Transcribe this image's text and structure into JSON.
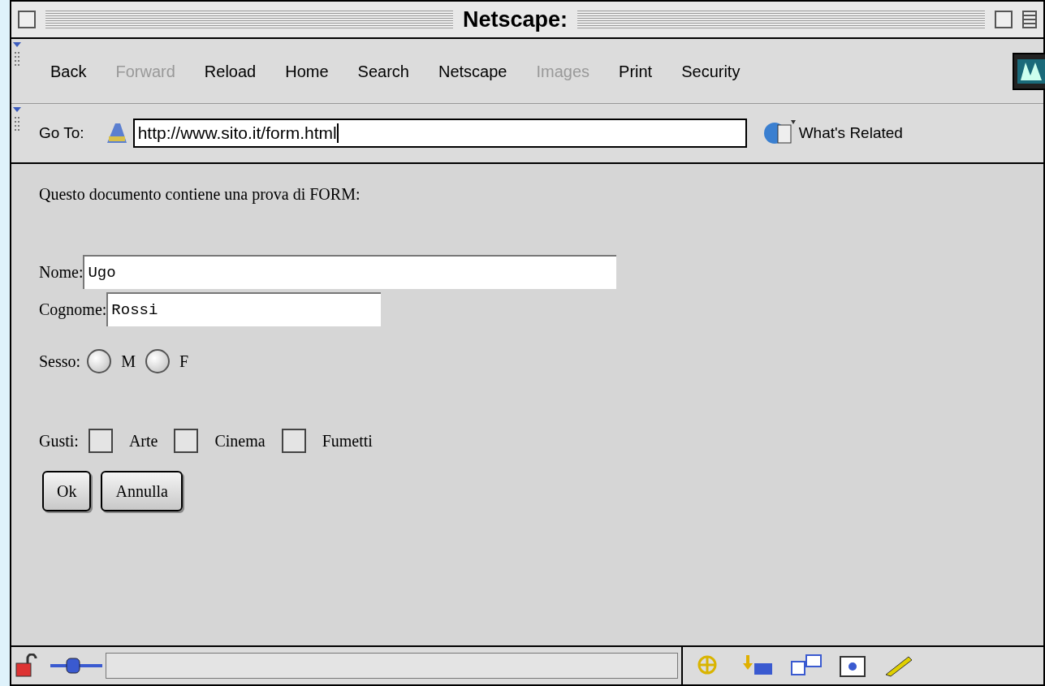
{
  "window": {
    "title": "Netscape:"
  },
  "toolbar": [
    {
      "label": "Back",
      "disabled": false
    },
    {
      "label": "Forward",
      "disabled": true
    },
    {
      "label": "Reload",
      "disabled": false
    },
    {
      "label": "Home",
      "disabled": false
    },
    {
      "label": "Search",
      "disabled": false
    },
    {
      "label": "Netscape",
      "disabled": false
    },
    {
      "label": "Images",
      "disabled": true
    },
    {
      "label": "Print",
      "disabled": false
    },
    {
      "label": "Security",
      "disabled": false
    }
  ],
  "location": {
    "label": "Go To:",
    "value": "http://www.sito.it/form.html",
    "related": "What's Related"
  },
  "page": {
    "intro": "Questo documento contiene una prova di FORM:",
    "fields": [
      {
        "label": "Nome:",
        "value": "Ugo"
      },
      {
        "label": "Cognome:",
        "value": "Rossi"
      }
    ],
    "radio_group": {
      "label": "Sesso:",
      "options": [
        {
          "label": "M",
          "selected": false
        },
        {
          "label": "F",
          "selected": false
        }
      ]
    },
    "checkbox_group": {
      "label": "Gusti:",
      "options": [
        {
          "label": "Arte",
          "checked": false
        },
        {
          "label": "Cinema",
          "checked": false
        },
        {
          "label": "Fumetti",
          "checked": false
        }
      ]
    },
    "buttons": [
      "Ok",
      "Annulla"
    ]
  }
}
